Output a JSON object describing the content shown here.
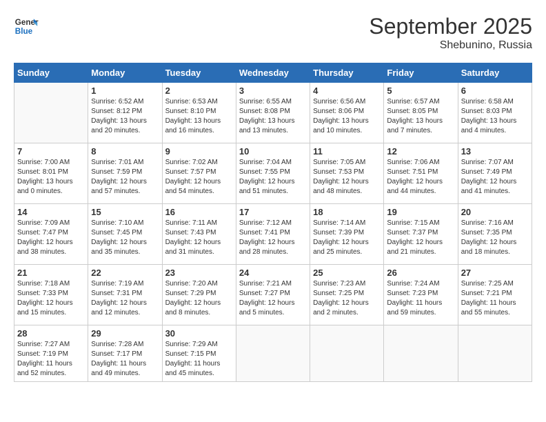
{
  "header": {
    "logo": {
      "line1": "General",
      "line2": "Blue"
    },
    "month": "September 2025",
    "location": "Shebunino, Russia"
  },
  "days_of_week": [
    "Sunday",
    "Monday",
    "Tuesday",
    "Wednesday",
    "Thursday",
    "Friday",
    "Saturday"
  ],
  "weeks": [
    [
      {
        "day": "",
        "empty": true
      },
      {
        "day": "1",
        "sunrise": "Sunrise: 6:52 AM",
        "sunset": "Sunset: 8:12 PM",
        "daylight": "Daylight: 13 hours and 20 minutes."
      },
      {
        "day": "2",
        "sunrise": "Sunrise: 6:53 AM",
        "sunset": "Sunset: 8:10 PM",
        "daylight": "Daylight: 13 hours and 16 minutes."
      },
      {
        "day": "3",
        "sunrise": "Sunrise: 6:55 AM",
        "sunset": "Sunset: 8:08 PM",
        "daylight": "Daylight: 13 hours and 13 minutes."
      },
      {
        "day": "4",
        "sunrise": "Sunrise: 6:56 AM",
        "sunset": "Sunset: 8:06 PM",
        "daylight": "Daylight: 13 hours and 10 minutes."
      },
      {
        "day": "5",
        "sunrise": "Sunrise: 6:57 AM",
        "sunset": "Sunset: 8:05 PM",
        "daylight": "Daylight: 13 hours and 7 minutes."
      },
      {
        "day": "6",
        "sunrise": "Sunrise: 6:58 AM",
        "sunset": "Sunset: 8:03 PM",
        "daylight": "Daylight: 13 hours and 4 minutes."
      }
    ],
    [
      {
        "day": "7",
        "sunrise": "Sunrise: 7:00 AM",
        "sunset": "Sunset: 8:01 PM",
        "daylight": "Daylight: 13 hours and 0 minutes."
      },
      {
        "day": "8",
        "sunrise": "Sunrise: 7:01 AM",
        "sunset": "Sunset: 7:59 PM",
        "daylight": "Daylight: 12 hours and 57 minutes."
      },
      {
        "day": "9",
        "sunrise": "Sunrise: 7:02 AM",
        "sunset": "Sunset: 7:57 PM",
        "daylight": "Daylight: 12 hours and 54 minutes."
      },
      {
        "day": "10",
        "sunrise": "Sunrise: 7:04 AM",
        "sunset": "Sunset: 7:55 PM",
        "daylight": "Daylight: 12 hours and 51 minutes."
      },
      {
        "day": "11",
        "sunrise": "Sunrise: 7:05 AM",
        "sunset": "Sunset: 7:53 PM",
        "daylight": "Daylight: 12 hours and 48 minutes."
      },
      {
        "day": "12",
        "sunrise": "Sunrise: 7:06 AM",
        "sunset": "Sunset: 7:51 PM",
        "daylight": "Daylight: 12 hours and 44 minutes."
      },
      {
        "day": "13",
        "sunrise": "Sunrise: 7:07 AM",
        "sunset": "Sunset: 7:49 PM",
        "daylight": "Daylight: 12 hours and 41 minutes."
      }
    ],
    [
      {
        "day": "14",
        "sunrise": "Sunrise: 7:09 AM",
        "sunset": "Sunset: 7:47 PM",
        "daylight": "Daylight: 12 hours and 38 minutes."
      },
      {
        "day": "15",
        "sunrise": "Sunrise: 7:10 AM",
        "sunset": "Sunset: 7:45 PM",
        "daylight": "Daylight: 12 hours and 35 minutes."
      },
      {
        "day": "16",
        "sunrise": "Sunrise: 7:11 AM",
        "sunset": "Sunset: 7:43 PM",
        "daylight": "Daylight: 12 hours and 31 minutes."
      },
      {
        "day": "17",
        "sunrise": "Sunrise: 7:12 AM",
        "sunset": "Sunset: 7:41 PM",
        "daylight": "Daylight: 12 hours and 28 minutes."
      },
      {
        "day": "18",
        "sunrise": "Sunrise: 7:14 AM",
        "sunset": "Sunset: 7:39 PM",
        "daylight": "Daylight: 12 hours and 25 minutes."
      },
      {
        "day": "19",
        "sunrise": "Sunrise: 7:15 AM",
        "sunset": "Sunset: 7:37 PM",
        "daylight": "Daylight: 12 hours and 21 minutes."
      },
      {
        "day": "20",
        "sunrise": "Sunrise: 7:16 AM",
        "sunset": "Sunset: 7:35 PM",
        "daylight": "Daylight: 12 hours and 18 minutes."
      }
    ],
    [
      {
        "day": "21",
        "sunrise": "Sunrise: 7:18 AM",
        "sunset": "Sunset: 7:33 PM",
        "daylight": "Daylight: 12 hours and 15 minutes."
      },
      {
        "day": "22",
        "sunrise": "Sunrise: 7:19 AM",
        "sunset": "Sunset: 7:31 PM",
        "daylight": "Daylight: 12 hours and 12 minutes."
      },
      {
        "day": "23",
        "sunrise": "Sunrise: 7:20 AM",
        "sunset": "Sunset: 7:29 PM",
        "daylight": "Daylight: 12 hours and 8 minutes."
      },
      {
        "day": "24",
        "sunrise": "Sunrise: 7:21 AM",
        "sunset": "Sunset: 7:27 PM",
        "daylight": "Daylight: 12 hours and 5 minutes."
      },
      {
        "day": "25",
        "sunrise": "Sunrise: 7:23 AM",
        "sunset": "Sunset: 7:25 PM",
        "daylight": "Daylight: 12 hours and 2 minutes."
      },
      {
        "day": "26",
        "sunrise": "Sunrise: 7:24 AM",
        "sunset": "Sunset: 7:23 PM",
        "daylight": "Daylight: 11 hours and 59 minutes."
      },
      {
        "day": "27",
        "sunrise": "Sunrise: 7:25 AM",
        "sunset": "Sunset: 7:21 PM",
        "daylight": "Daylight: 11 hours and 55 minutes."
      }
    ],
    [
      {
        "day": "28",
        "sunrise": "Sunrise: 7:27 AM",
        "sunset": "Sunset: 7:19 PM",
        "daylight": "Daylight: 11 hours and 52 minutes."
      },
      {
        "day": "29",
        "sunrise": "Sunrise: 7:28 AM",
        "sunset": "Sunset: 7:17 PM",
        "daylight": "Daylight: 11 hours and 49 minutes."
      },
      {
        "day": "30",
        "sunrise": "Sunrise: 7:29 AM",
        "sunset": "Sunset: 7:15 PM",
        "daylight": "Daylight: 11 hours and 45 minutes."
      },
      {
        "day": "",
        "empty": true
      },
      {
        "day": "",
        "empty": true
      },
      {
        "day": "",
        "empty": true
      },
      {
        "day": "",
        "empty": true
      }
    ]
  ]
}
